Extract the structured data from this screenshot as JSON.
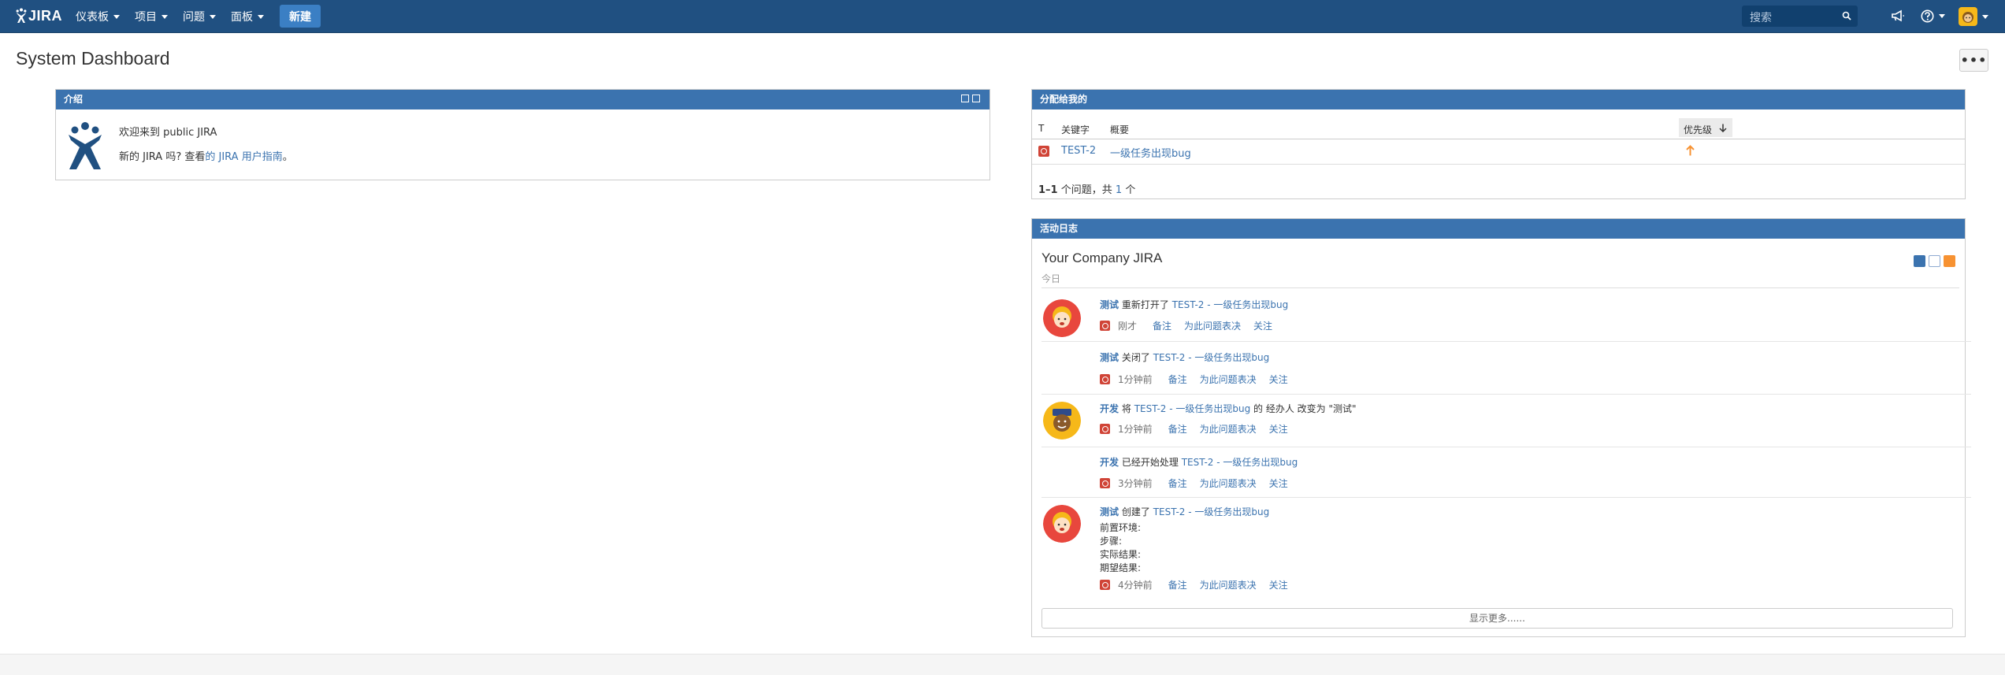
{
  "topbar": {
    "logo_text": "JIRA",
    "nav": [
      {
        "label": "仪表板"
      },
      {
        "label": "项目"
      },
      {
        "label": "问题"
      },
      {
        "label": "面板"
      }
    ],
    "create_label": "新建",
    "search_placeholder": "搜索"
  },
  "page": {
    "title": "System Dashboard",
    "more_label": "•••"
  },
  "intro": {
    "heading": "介绍",
    "welcome": "欢迎来到 public JIRA",
    "guide_prefix": "新的 JIRA 吗? 查看",
    "guide_link": "的 JIRA 用户指南",
    "guide_suffix": "。"
  },
  "assigned": {
    "heading": "分配给我的",
    "columns": [
      "T",
      "关键字",
      "概要",
      "优先级"
    ],
    "issues": [
      {
        "key": "TEST-2",
        "summary": "一级任务出现bug",
        "priority_icon": "arrow-up-icon"
      }
    ],
    "count_range": "1–1",
    "count_text_a": "个问题，共",
    "count_total": "1",
    "count_text_b": "个"
  },
  "activity": {
    "heading": "活动日志",
    "title": "Your Company JIRA",
    "today": "今日",
    "actions": [
      "备注",
      "为此问题表决",
      "关注"
    ],
    "entries": [
      {
        "user": "测试",
        "verb": "重新打开了",
        "issue": "TEST-2 - 一级任务出现bug",
        "tail": "",
        "time": "刚才",
        "avatar": "test-user-avatar"
      },
      {
        "user": "测试",
        "verb": "关闭了",
        "issue": "TEST-2 - 一级任务出现bug",
        "tail": "",
        "time": "1分钟前"
      },
      {
        "user": "开发",
        "verb": "将",
        "issue": "TEST-2 - 一级任务出现bug",
        "tail": "的 经办人 改变为 \"测试\"",
        "time": "1分钟前",
        "avatar": "dev-user-avatar"
      },
      {
        "user": "开发",
        "verb": "已经开始处理",
        "issue": "TEST-2 - 一级任务出现bug",
        "tail": "",
        "time": "3分钟前"
      },
      {
        "user": "测试",
        "verb": "创建了",
        "issue": "TEST-2 - 一级任务出现bug",
        "tail": "",
        "time": "4分钟前",
        "avatar": "test-user-avatar",
        "description": [
          "前置环境:",
          "步骤:",
          "实际结果:",
          "期望结果:"
        ]
      }
    ],
    "show_more": "显示更多......"
  },
  "colors": {
    "header_bg": "#205081",
    "gadget_head": "#3b73af",
    "link": "#3b73af",
    "bug": "#d04437",
    "priority": "#f79232"
  }
}
